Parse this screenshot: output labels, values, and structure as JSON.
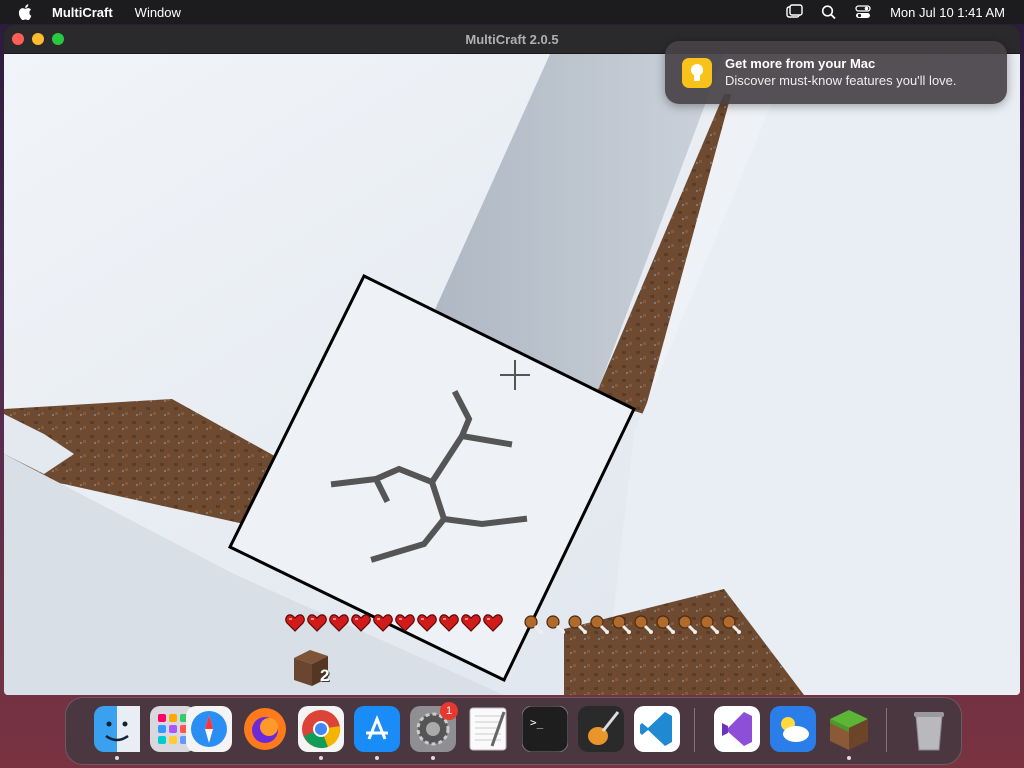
{
  "menubar": {
    "app_name": "MultiCraft",
    "menus": [
      "Window"
    ],
    "clock": "Mon Jul 10  1:41 AM",
    "status_icons": [
      "screen-mirroring-icon",
      "search-icon",
      "control-center-icon"
    ]
  },
  "window": {
    "title": "MultiCraft 2.0.5"
  },
  "notification": {
    "title": "Get more from your Mac",
    "body": "Discover must-know features you'll love.",
    "icon": "tips-lightbulb-icon"
  },
  "game": {
    "hearts": 10,
    "hunger": 10,
    "hotbar_item": "dirt-block",
    "hotbar_count": "2"
  },
  "dock": {
    "apps": [
      {
        "name": "finder-icon",
        "running": true
      },
      {
        "name": "launchpad-icon",
        "running": false
      },
      {
        "name": "safari-icon",
        "running": false
      },
      {
        "name": "firefox-icon",
        "running": false
      },
      {
        "name": "chrome-icon",
        "running": true
      },
      {
        "name": "app-store-icon",
        "running": true
      },
      {
        "name": "system-settings-icon",
        "running": true,
        "badge": "1"
      },
      {
        "name": "textedit-icon",
        "running": false
      },
      {
        "name": "terminal-icon",
        "running": false
      },
      {
        "name": "garageband-icon",
        "running": false
      },
      {
        "name": "vscode-icon",
        "running": false
      },
      {
        "name": "visual-studio-icon",
        "running": false
      },
      {
        "name": "weather-icon",
        "running": false
      },
      {
        "name": "multicraft-icon",
        "running": true
      },
      {
        "name": "trash-icon",
        "running": false
      }
    ]
  },
  "colors": {
    "menubar_bg": "#1c1c1e",
    "snow": "#e8edf3",
    "dirt": "#6e4a30",
    "heart": "#d11a1a",
    "notification_bg": "#464246"
  }
}
